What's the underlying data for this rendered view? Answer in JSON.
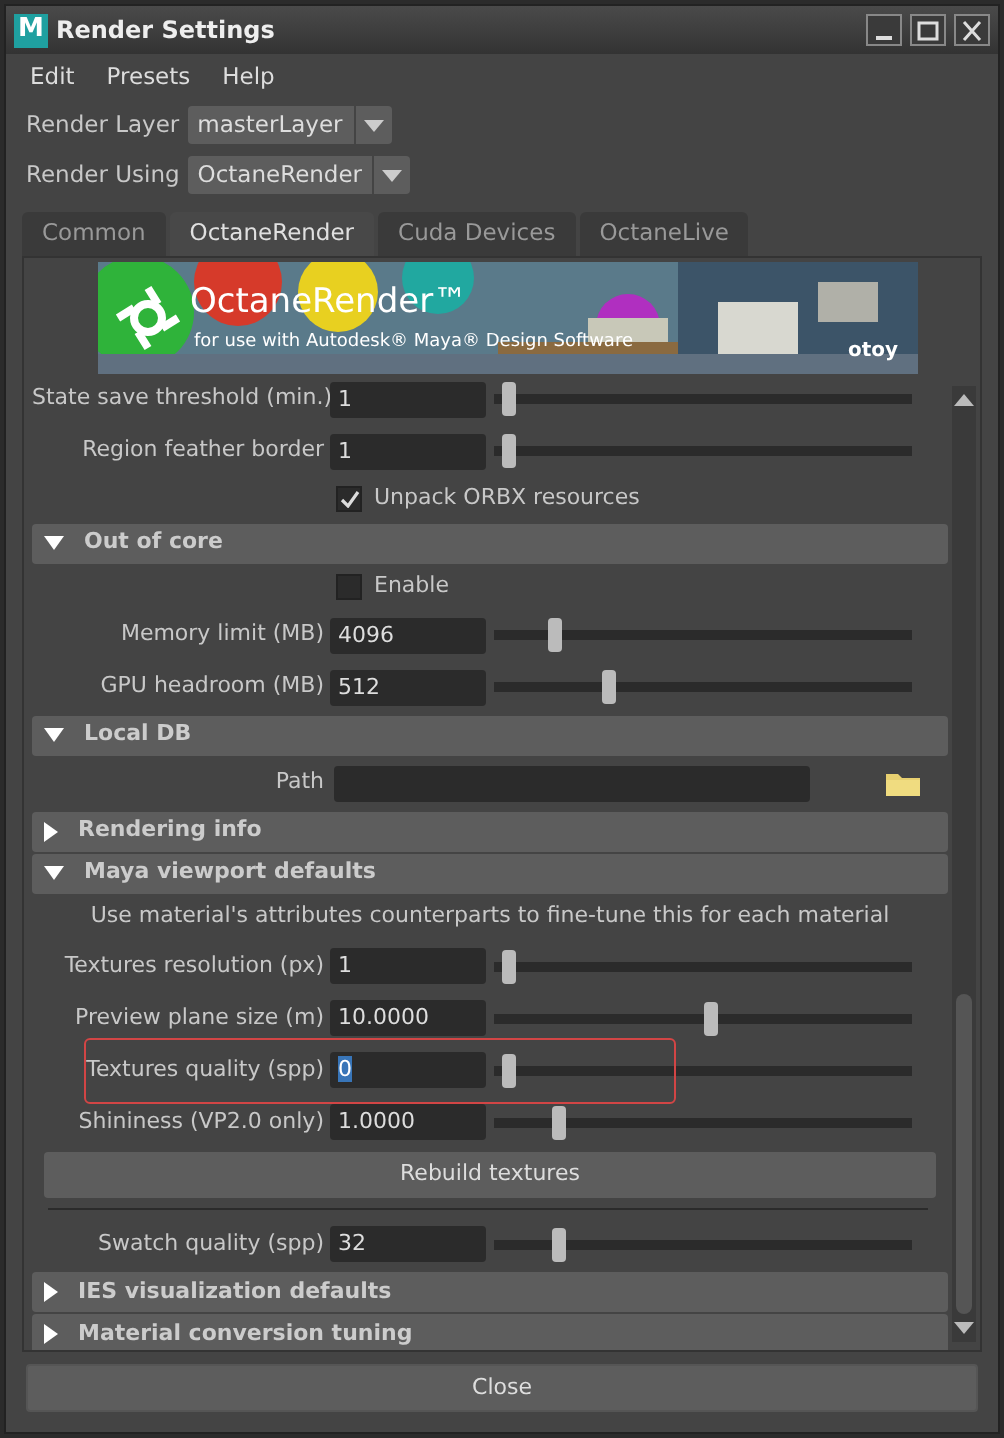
{
  "window": {
    "title": "Render Settings",
    "icon_letter": "M"
  },
  "menu": [
    "Edit",
    "Presets",
    "Help"
  ],
  "dropdowns": [
    {
      "label": "Render Layer",
      "value": "masterLayer"
    },
    {
      "label": "Render Using",
      "value": "OctaneRender"
    }
  ],
  "tabs": [
    {
      "label": "Common",
      "selected": false
    },
    {
      "label": "OctaneRender",
      "selected": true
    },
    {
      "label": "Cuda Devices",
      "selected": false
    },
    {
      "label": "OctaneLive",
      "selected": false
    }
  ],
  "banner": {
    "kind": "picture",
    "title": "OctaneRender™",
    "subtitle": "for use with Autodesk® Maya® Design Software",
    "logo": "otoy"
  },
  "items": [
    {
      "kind": "slider",
      "label": "State save threshold (min.)",
      "value": "1",
      "level": 0.02
    },
    {
      "kind": "slider",
      "label": "Region feather border",
      "value": "1",
      "level": 0.02
    },
    {
      "kind": "checkbox",
      "label": "Unpack ORBX resources",
      "checked": true
    },
    {
      "kind": "section",
      "label": "Out of core",
      "expanded": true,
      "children": [
        {
          "kind": "checkbox",
          "label": "Enable",
          "checked": false
        },
        {
          "kind": "slider",
          "label": "Memory limit (MB)",
          "value": "4096",
          "level": 0.13
        },
        {
          "kind": "slider",
          "label": "GPU headroom (MB)",
          "value": "512",
          "level": 0.26
        }
      ]
    },
    {
      "kind": "section",
      "label": "Local DB",
      "expanded": true,
      "children": [
        {
          "kind": "path",
          "label": "Path"
        }
      ]
    },
    {
      "kind": "section",
      "label": "Rendering info",
      "expanded": false
    },
    {
      "kind": "section",
      "label": "Maya viewport defaults",
      "expanded": true,
      "children": [
        {
          "kind": "note",
          "label": "Use material's attributes counterparts to fine-tune this for each material"
        },
        {
          "kind": "slider",
          "label": "Textures resolution (px)",
          "value": "1",
          "level": 0.02
        },
        {
          "kind": "slider",
          "label": "Preview plane size (m)",
          "value": "10.0000",
          "level": 0.5
        },
        {
          "kind": "slider",
          "label": "Textures quality (spp)",
          "value": "0",
          "level": 0.02,
          "highlighted": true,
          "text_selected": true
        },
        {
          "kind": "slider",
          "label": "Shininess (VP2.0 only)",
          "value": "1.0000",
          "level": 0.14
        },
        {
          "kind": "button",
          "label": "Rebuild textures"
        },
        {
          "kind": "separator"
        },
        {
          "kind": "slider",
          "label": "Swatch quality (spp)",
          "value": "32",
          "level": 0.14
        },
        {
          "kind": "section",
          "label": "IES visualization defaults",
          "expanded": false
        }
      ]
    },
    {
      "kind": "section",
      "label": "Material conversion tuning",
      "expanded": false
    }
  ],
  "footer_button": "Close"
}
